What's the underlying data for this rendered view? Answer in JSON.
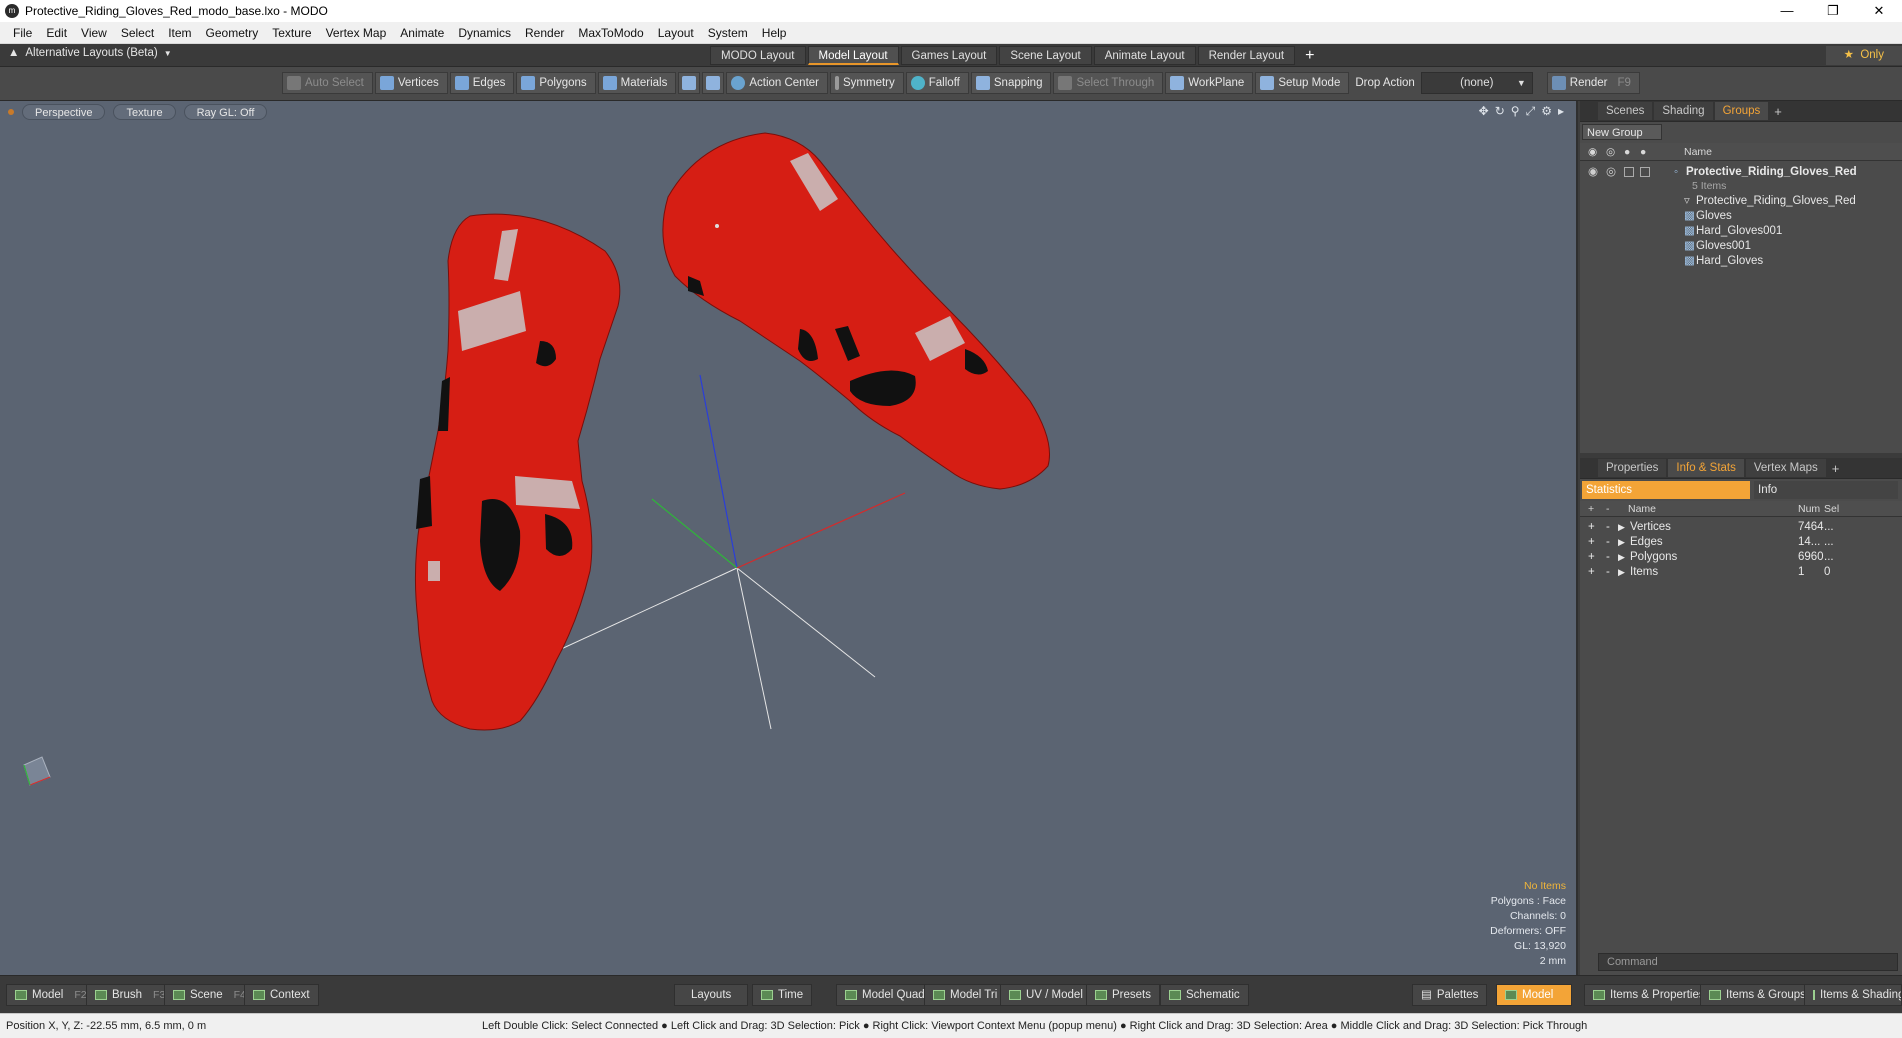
{
  "window": {
    "title": "Protective_Riding_Gloves_Red_modo_base.lxo - MODO",
    "app_icon": "m"
  },
  "menu": [
    "File",
    "Edit",
    "View",
    "Select",
    "Item",
    "Geometry",
    "Texture",
    "Vertex Map",
    "Animate",
    "Dynamics",
    "Render",
    "MaxToModo",
    "Layout",
    "System",
    "Help"
  ],
  "layoutbar": {
    "alt_layouts": "Alternative Layouts (Beta)",
    "tabs": [
      "MODO Layout",
      "Model Layout",
      "Games Layout",
      "Scene Layout",
      "Animate Layout",
      "Render Layout"
    ],
    "active_tab": "Model Layout",
    "only": "Only"
  },
  "toolbar": {
    "auto_select": "Auto Select",
    "vertices": "Vertices",
    "edges": "Edges",
    "polygons": "Polygons",
    "materials": "Materials",
    "action_center": "Action Center",
    "symmetry": "Symmetry",
    "falloff": "Falloff",
    "snapping": "Snapping",
    "select_through": "Select Through",
    "workplane": "WorkPlane",
    "setup_mode": "Setup Mode",
    "drop_action_label": "Drop Action",
    "drop_action_value": "(none)",
    "render": "Render",
    "render_key": "F9"
  },
  "viewport": {
    "perspective": "Perspective",
    "texture": "Texture",
    "raygl": "Ray GL: Off",
    "overlay": {
      "selection": "No Items",
      "polygons": "Polygons : Face",
      "channels": "Channels: 0",
      "deformers": "Deformers: OFF",
      "gl": "GL: 13,920",
      "scale": "2 mm"
    }
  },
  "groups_panel": {
    "tabs": [
      "Scenes",
      "Shading",
      "Groups"
    ],
    "active_tab": "Groups",
    "new_group": "New Group",
    "name_header": "Name",
    "root": {
      "name": "Protective_Riding_Gloves_Red",
      "count": "5 Items"
    },
    "items": [
      "Protective_Riding_Gloves_Red",
      "Gloves",
      "Hard_Gloves001",
      "Gloves001",
      "Hard_Gloves"
    ]
  },
  "info_panel": {
    "tabs": [
      "Properties",
      "Info & Stats",
      "Vertex Maps"
    ],
    "active_tab": "Info & Stats",
    "statistics": "Statistics",
    "info": "Info",
    "headers": {
      "name": "Name",
      "num": "Num",
      "sel": "Sel"
    },
    "rows": [
      {
        "name": "Vertices",
        "num": "7464",
        "sel": "..."
      },
      {
        "name": "Edges",
        "num": "14...",
        "sel": "..."
      },
      {
        "name": "Polygons",
        "num": "6960",
        "sel": "..."
      },
      {
        "name": "Items",
        "num": "1",
        "sel": "0"
      }
    ],
    "command_placeholder": "Command"
  },
  "bottombar": {
    "model": "Model",
    "model_key": "F2",
    "brush": "Brush",
    "brush_key": "F3",
    "scene": "Scene",
    "scene_key": "F4",
    "context": "Context",
    "layouts": "Layouts",
    "time": "Time",
    "model_quad": "Model Quad",
    "model_tri": "Model Tri",
    "uv_model": "UV / Model",
    "presets": "Presets",
    "schematic": "Schematic",
    "palettes": "Palettes",
    "model_active": "Model",
    "items_properties": "Items & Properties",
    "items_groups": "Items & Groups",
    "items_shading": "Items & Shading"
  },
  "statusbar": {
    "position": "Position X, Y, Z:   -22.55 mm, 6.5 mm, 0 m",
    "hints": "Left Double Click: Select Connected ● Left Click and Drag: 3D Selection: Pick ● Right Click: Viewport Context Menu (popup menu) ● Right Click and Drag: 3D Selection: Area ● Middle Click and Drag: 3D Selection: Pick Through"
  },
  "colors": {
    "accent": "#f3a437",
    "viewport_bg": "#5b6472",
    "glove_red": "#d61e14"
  }
}
